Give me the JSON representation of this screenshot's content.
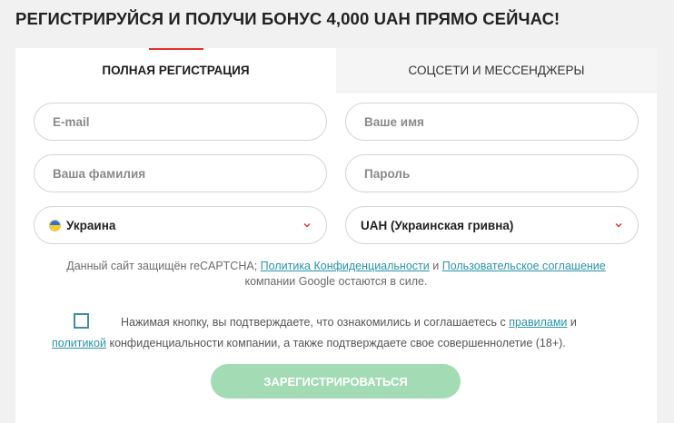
{
  "page": {
    "title": "РЕГИСТРИРУЙСЯ И ПОЛУЧИ БОНУС 4,000 UAH ПРЯМО СЕЙЧАС!"
  },
  "tabs": [
    {
      "label": "ПОЛНАЯ РЕГИСТРАЦИЯ",
      "active": true
    },
    {
      "label": "СОЦСЕТИ И МЕССЕНДЖЕРЫ",
      "active": false
    }
  ],
  "form": {
    "email_placeholder": "E-mail",
    "name_placeholder": "Ваше имя",
    "surname_placeholder": "Ваша фамилия",
    "password_placeholder": "Пароль",
    "country_value": "Украина",
    "currency_value": "UAH (Украинская гривна)"
  },
  "recaptcha": {
    "prefix": "Данный сайт защищён reCAPTCHA;",
    "privacy_link": "Политика Конфиденциальности",
    "and": "и",
    "terms_link": "Пользовательское соглашение",
    "suffix": "компании Google остаются в силе."
  },
  "consent": {
    "text1": "Нажимая кнопку, вы подтверждаете, что ознакомились и соглашаетесь с",
    "rules_link": "правилами",
    "and": "и",
    "policy_link": "политикой",
    "text2": "конфиденциальности компании, а также подтверждаете свое совершеннолетие (18+).",
    "checked": false
  },
  "submit_label": "ЗАРЕГИСТРИРОВАТЬСЯ",
  "colors": {
    "accent_red": "#e2312d",
    "link_teal": "#2a93a8",
    "submit_green": "#a3dbb5"
  },
  "icons": {
    "country_flag": "ukraine-flag-icon",
    "dropdown": "chevron-down-icon"
  }
}
